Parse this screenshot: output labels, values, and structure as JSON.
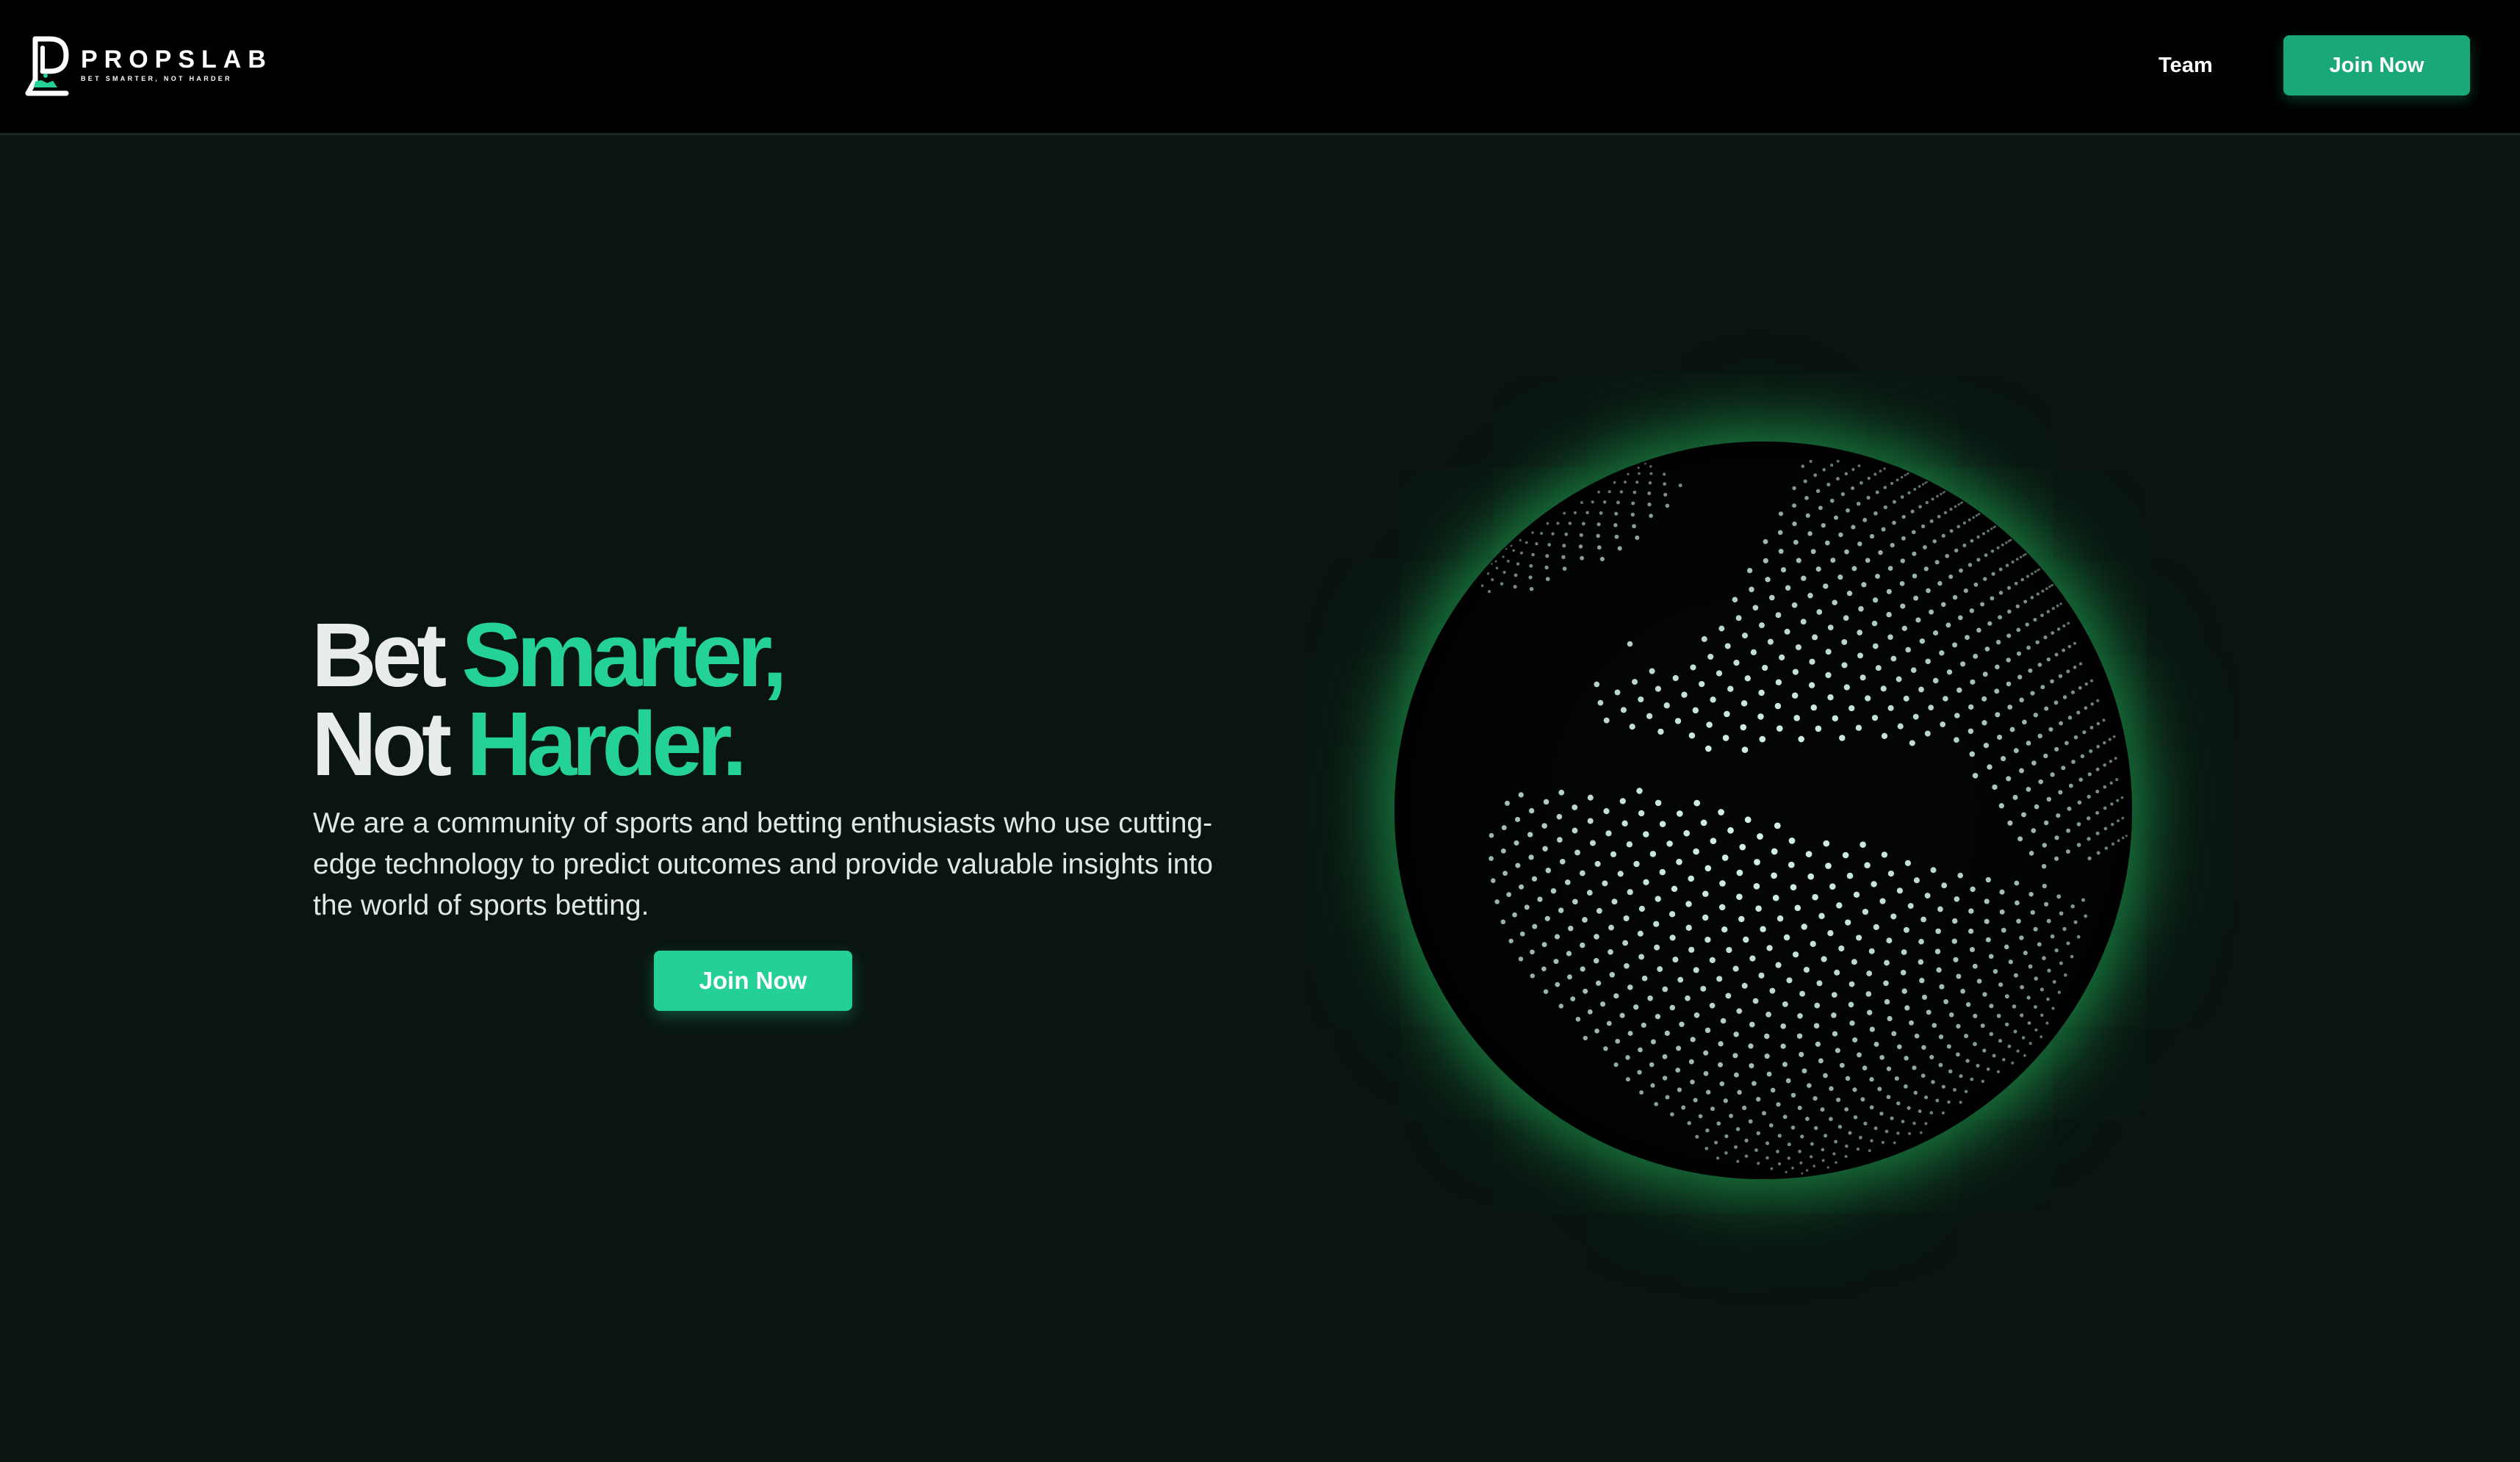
{
  "header": {
    "brand_name": "PROPSLAB",
    "brand_tagline": "BET SMARTER, NOT HARDER",
    "nav_team": "Team",
    "nav_join": "Join Now"
  },
  "hero": {
    "headline_line1_plain": "Bet",
    "headline_line1_accent": "Smarter,",
    "headline_line2_plain": "Not",
    "headline_line2_accent": "Harder.",
    "description": "We are a community of sports and betting enthusiasts who use cutting-edge technology to predict outcomes and provide valuable insights into the world of sports betting.",
    "cta": "Join Now"
  },
  "colors": {
    "accent": "#25d295",
    "button": "#1ba877",
    "background": "#0a1511",
    "header": "#000000",
    "globe_glow": "#22b45a"
  },
  "icons": {
    "logo": "flask-p-logo-icon",
    "globe": "dotted-globe-graphic"
  }
}
